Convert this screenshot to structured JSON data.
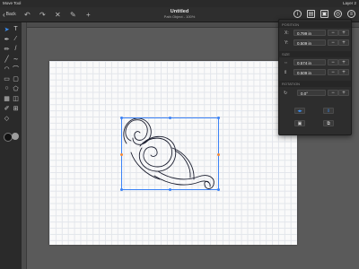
{
  "statusbar": {
    "tool": "Move Tool",
    "layer": "Layer 2"
  },
  "toolbar": {
    "back_label": "Back",
    "title": "Untitled",
    "subtitle": "Path Object - 100%",
    "icons": [
      "undo-icon",
      "redo-icon",
      "delete-icon",
      "edit-icon",
      "add-icon"
    ],
    "right_icons": [
      "info-icon",
      "inspector-icon",
      "layers-icon",
      "export-icon",
      "stack-icon"
    ]
  },
  "tools": [
    "select-arrow-icon",
    "text-tool-icon",
    "pen-tool-icon",
    "brush-tool-icon",
    "pencil-tool-icon",
    "eraser-tool-icon",
    "line-tool-icon",
    "curve-tool-icon",
    "arc-tool-icon",
    "rectangle-tool-icon",
    "rounded-rectangle-tool-icon",
    "circle-tool-icon",
    "polygon-tool-icon",
    "image-tool-icon",
    "eyedropper-tool-icon",
    "node-tool-icon",
    "crop-tool-icon"
  ],
  "colors": {
    "stroke": "#111111",
    "fill": "#9e9e9e",
    "accent": "#3b82f6",
    "handle_alt": "#f08a3c"
  },
  "inspector": {
    "position_header": "POSITION",
    "x_label": "X:",
    "x_value": "0.799 in",
    "y_label": "Y:",
    "y_value": "0.509 in",
    "size_header": "SIZE",
    "w_label": "",
    "w_value": "0.574 in",
    "h_label": "",
    "h_value": "0.509 in",
    "rotation_header": "ROTATION",
    "rotation_value": "0.0°",
    "minus": "−",
    "plus": "+"
  }
}
